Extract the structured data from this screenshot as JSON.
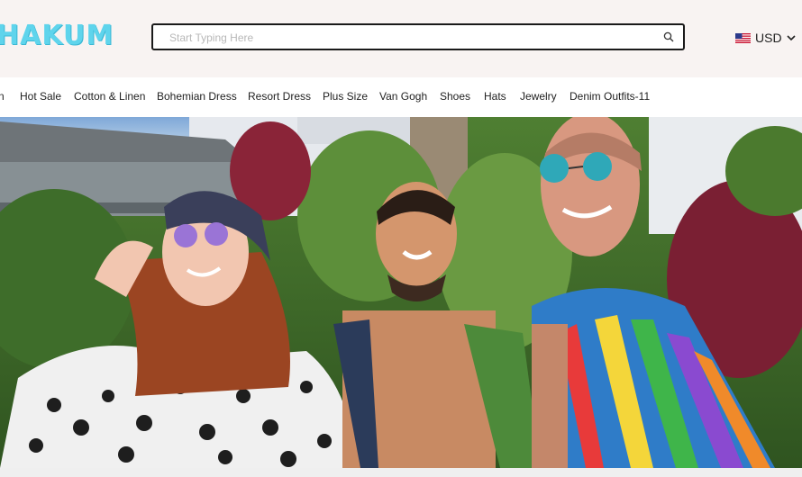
{
  "header": {
    "logo_text": "HAKUM",
    "search": {
      "placeholder": "Start Typing Here",
      "value": ""
    },
    "currency": {
      "label": "USD",
      "flag": "us-flag-icon"
    }
  },
  "nav": {
    "items": [
      {
        "label": "n"
      },
      {
        "label": "Hot Sale"
      },
      {
        "label": "Cotton & Linen"
      },
      {
        "label": "Bohemian Dress"
      },
      {
        "label": "Resort Dress"
      },
      {
        "label": "Plus Size"
      },
      {
        "label": "Van Gogh"
      },
      {
        "label": "Shoes"
      },
      {
        "label": "Hats"
      },
      {
        "label": "Jewelry"
      },
      {
        "label": "Denim Outfits-11"
      }
    ]
  },
  "hero": {
    "image": "banner-photo-three-models-tropical-resort"
  },
  "colors": {
    "header_bg": "#f8f3f2",
    "logo": "#5fd4ec",
    "search_border": "#1a1a1a",
    "text": "#222222"
  }
}
